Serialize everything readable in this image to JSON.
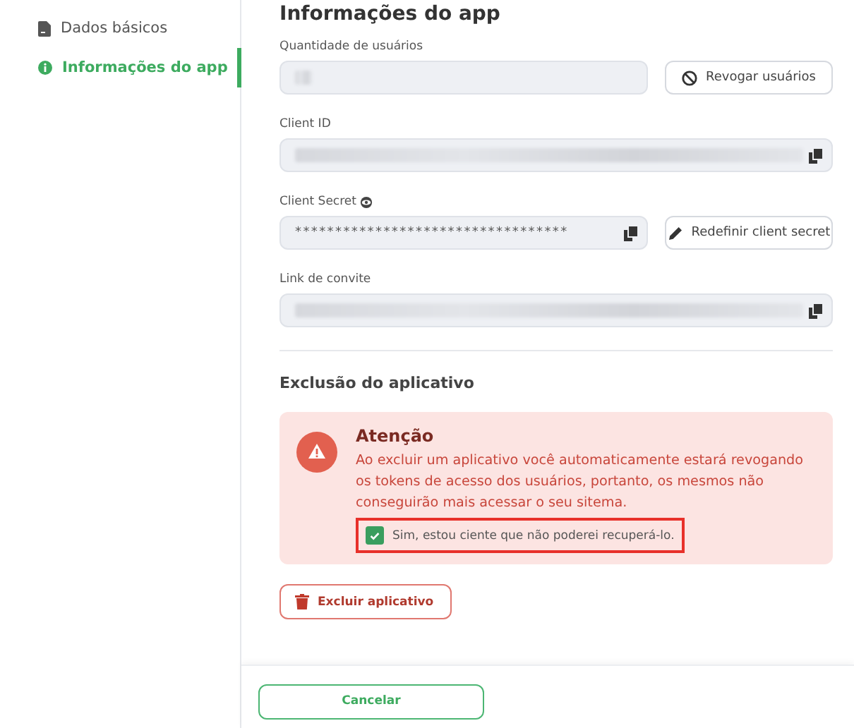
{
  "sidebar": {
    "items": [
      {
        "label": "Dados básicos",
        "selected": false
      },
      {
        "label": "Informações do app",
        "selected": true
      }
    ]
  },
  "section": {
    "title": "Informações do app",
    "fields": [
      {
        "label": "Quantidade de usuários",
        "kind": "short",
        "revealable": false,
        "copyable": false,
        "action": {
          "label": "Revogar usuários",
          "kind": "revoke"
        }
      },
      {
        "label": "Client ID",
        "kind": "long",
        "revealable": false,
        "copyable": true
      },
      {
        "label": "Client Secret",
        "kind": "masked",
        "value": "**********************************",
        "revealable": true,
        "copyable": true,
        "action": {
          "label": "Redefinir client secret",
          "kind": "reset"
        }
      },
      {
        "label": "Link de convite",
        "kind": "long",
        "revealable": false,
        "copyable": true
      }
    ]
  },
  "deletion": {
    "title": "Exclusão do aplicativo",
    "alert": {
      "title": "Atenção",
      "message": "Ao excluir um aplicativo você automaticamente estará revogando os tokens de acesso dos usuários, portanto, os mesmos não conseguirão mais acessar o seu sitema.",
      "confirm": {
        "label": "Sim, estou ciente que não poderei recuperá-lo.",
        "checked": true,
        "highlighted": true
      }
    },
    "button": "Excluir aplicativo"
  },
  "footer": {
    "button": "Cancelar"
  }
}
